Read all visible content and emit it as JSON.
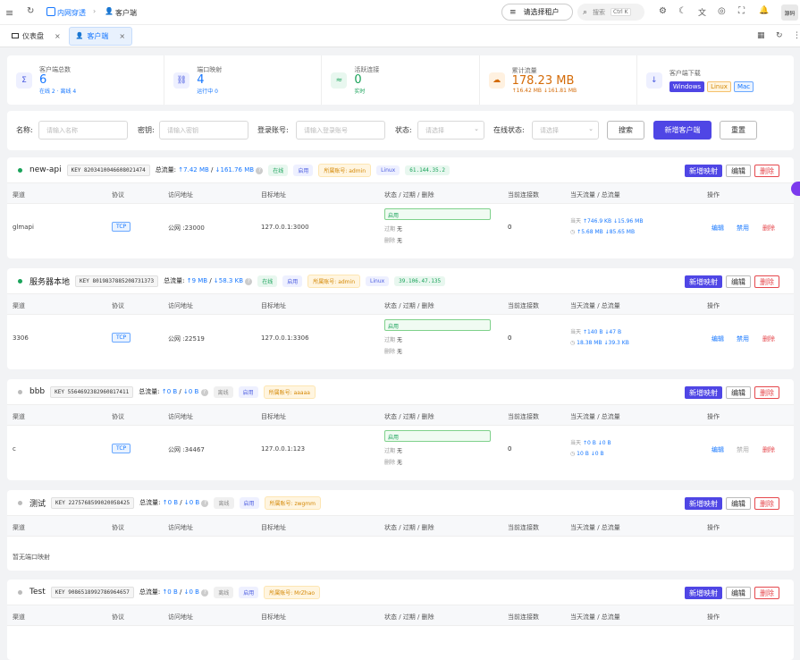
{
  "header": {
    "breadcrumb_root": "内网穿透",
    "breadcrumb_current": "客户端",
    "tenant_button": "请选择租户",
    "search_placeholder": "搜索",
    "search_shortcut": "Ctrl K",
    "avatar_text": "源码"
  },
  "tabs": [
    {
      "label": "仪表盘"
    },
    {
      "label": "客户端"
    }
  ],
  "stats": [
    {
      "title": "客户端总数",
      "value": "6",
      "sub": "在线 2 · 离线 4",
      "icon": "sigma-icon",
      "color": "#4b5ce0",
      "bg": "#eef0ff"
    },
    {
      "title": "端口映射",
      "value": "4",
      "sub": "运行中 0",
      "icon": "link-icon",
      "color": "#4b5ce0",
      "bg": "#eef0ff"
    },
    {
      "title": "活跃连接",
      "value": "0",
      "sub": "实时",
      "icon": "activity-icon",
      "color": "#1aa35a",
      "bg": "#e8f7ef"
    },
    {
      "title": "累计流量",
      "value": "178.23 MB",
      "sub": "↑16.42 MB ↓161.81 MB",
      "icon": "cloud-icon",
      "color": "#d46b08",
      "bg": "#fff1e0"
    },
    {
      "title": "客户端下载",
      "icon": "download-icon",
      "color": "#4b5ce0",
      "bg": "#eef0ff"
    }
  ],
  "downloads": {
    "windows": "Windows",
    "linux": "Linux",
    "mac": "Mac"
  },
  "filters": {
    "name_label": "名称:",
    "name_placeholder": "请输入名称",
    "key_label": "密钥:",
    "key_placeholder": "请输入密钥",
    "account_label": "登录账号:",
    "account_placeholder": "请输入登录账号",
    "status_label": "状态:",
    "status_placeholder": "请选择",
    "online_label": "在线状态:",
    "online_placeholder": "请选择",
    "search_btn": "搜索",
    "add_btn": "新增客户端",
    "reset_btn": "重置"
  },
  "columns": [
    "渠道",
    "协议",
    "访问地址",
    "目标地址",
    "状态 / 过期 / 删除",
    "当前连接数",
    "当天流量 / 总流量",
    "操作"
  ],
  "labels": {
    "key_prefix": "KEY",
    "traffic_label": "总流量:",
    "new_mapping": "新增映射",
    "edit": "编辑",
    "delete": "删除",
    "enabled": "启用",
    "disable": "禁用",
    "expire_prefix": "过期",
    "delete_prefix": "删除",
    "none": "无",
    "today": "当天",
    "empty": "暂无端口映射"
  },
  "clients": [
    {
      "name": "new-api",
      "key": "8203410046608021474",
      "online": true,
      "traffic_up": "↑7.42 MB",
      "traffic_down": "↓161.76 MB",
      "status": "在线",
      "state": "启用",
      "owner": "所属账号: admin",
      "os": "Linux",
      "ip": "61.144.35.2",
      "row": {
        "channel": "glmapi",
        "protocol": "TCP",
        "access": "公网 :23000",
        "target": "127.0.0.1:3000",
        "conns": "0",
        "today_up": "↑746.9 KB",
        "today_down": "↓15.96 MB",
        "total_up": "↑5.68 MB",
        "total_down": "↓85.65 MB",
        "disable_active": true
      }
    },
    {
      "name": "服务器本地",
      "key": "8019837885208731373",
      "online": true,
      "traffic_up": "↑9 MB",
      "traffic_down": "↓58.3 KB",
      "status": "在线",
      "state": "启用",
      "owner": "所属账号: admin",
      "os": "Linux",
      "ip": "39.106.47.135",
      "row": {
        "channel": "3306",
        "protocol": "TCP",
        "access": "公网 :22519",
        "target": "127.0.0.1:3306",
        "conns": "0",
        "today_up": "↑140 B",
        "today_down": "↓47 B",
        "total_up": "18.38 MB",
        "total_down": "↓39.3 KB",
        "disable_active": true
      }
    },
    {
      "name": "bbb",
      "key": "5564692382960817411",
      "online": false,
      "traffic_up": "↑0 B",
      "traffic_down": "↓0 B",
      "status": "离线",
      "state": "启用",
      "owner": "所属账号: aaaaa",
      "row": {
        "channel": "c",
        "protocol": "TCP",
        "access": "公网 :34467",
        "target": "127.0.0.1:123",
        "conns": "0",
        "today_up": "↑0 B",
        "today_down": "↓0 B",
        "total_up": "10 B",
        "total_down": "↓0 B",
        "disable_active": false
      }
    },
    {
      "name": "测试",
      "key": "2275768599020058425",
      "online": false,
      "traffic_up": "↑0 B",
      "traffic_down": "↓0 B",
      "status": "离线",
      "state": "启用",
      "owner": "所属账号: zwgmm",
      "empty": true
    },
    {
      "name": "Test",
      "key": "9086518992786964657",
      "online": false,
      "traffic_up": "↑0 B",
      "traffic_down": "↓0 B",
      "status": "离线",
      "state": "启用",
      "owner": "所属账号: MrZhao",
      "empty": true
    }
  ]
}
